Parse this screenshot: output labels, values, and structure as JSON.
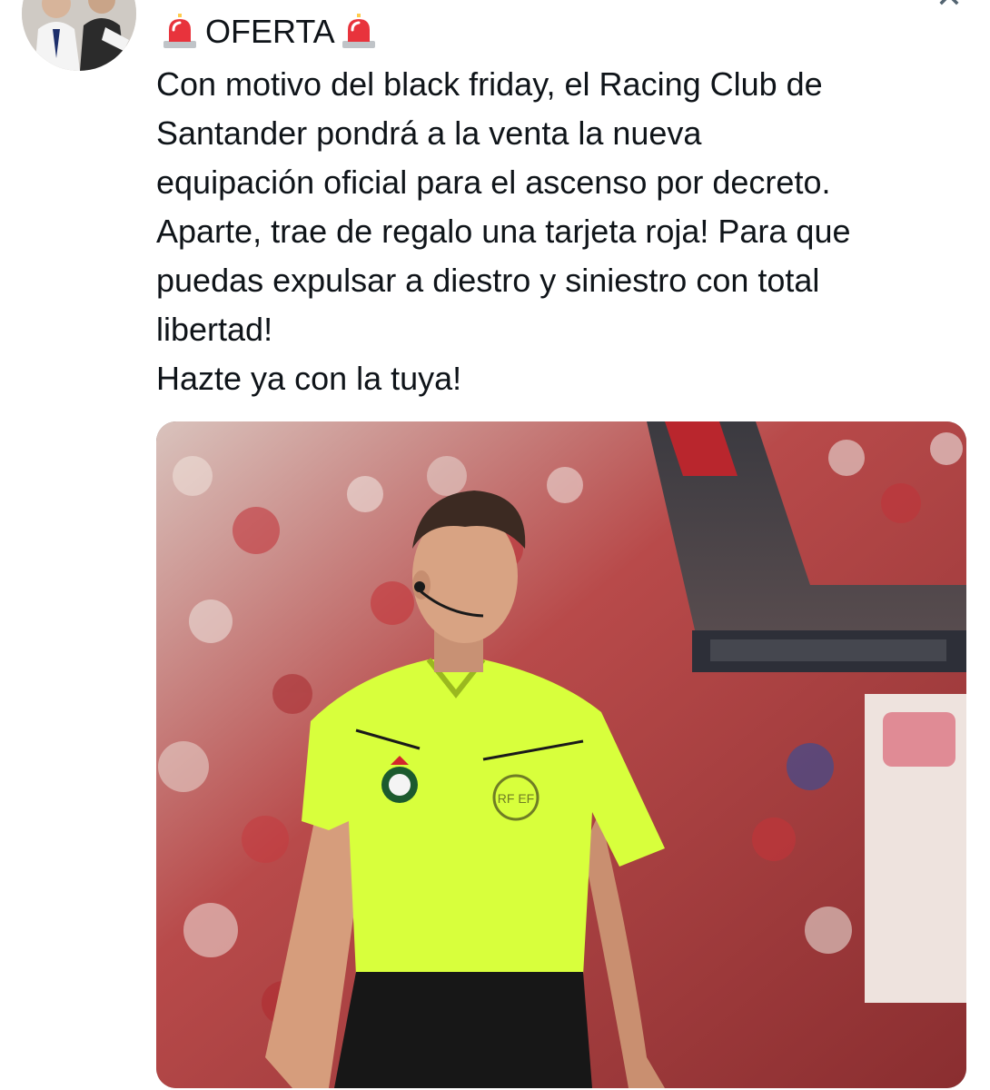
{
  "tweet": {
    "headline": "OFERTA",
    "lines": [
      "Con motivo del black friday, el Racing Club de",
      "Santander pondrá a la venta la nueva",
      "equipación oficial para el ascenso por decreto.",
      "Aparte, trae de regalo una tarjeta roja! Para que",
      "puedas expulsar a diestro y siniestro con total",
      "libertad!",
      "Hazte ya con la tuya!"
    ],
    "emoji": "rotating-light"
  },
  "photo": {
    "shirt_badge_text": "RF EF"
  },
  "colors": {
    "shirt": "#d8ff3c",
    "text": "#0f1419",
    "crowd_red": "#c2323a"
  },
  "icons": {
    "close": "close-icon"
  }
}
